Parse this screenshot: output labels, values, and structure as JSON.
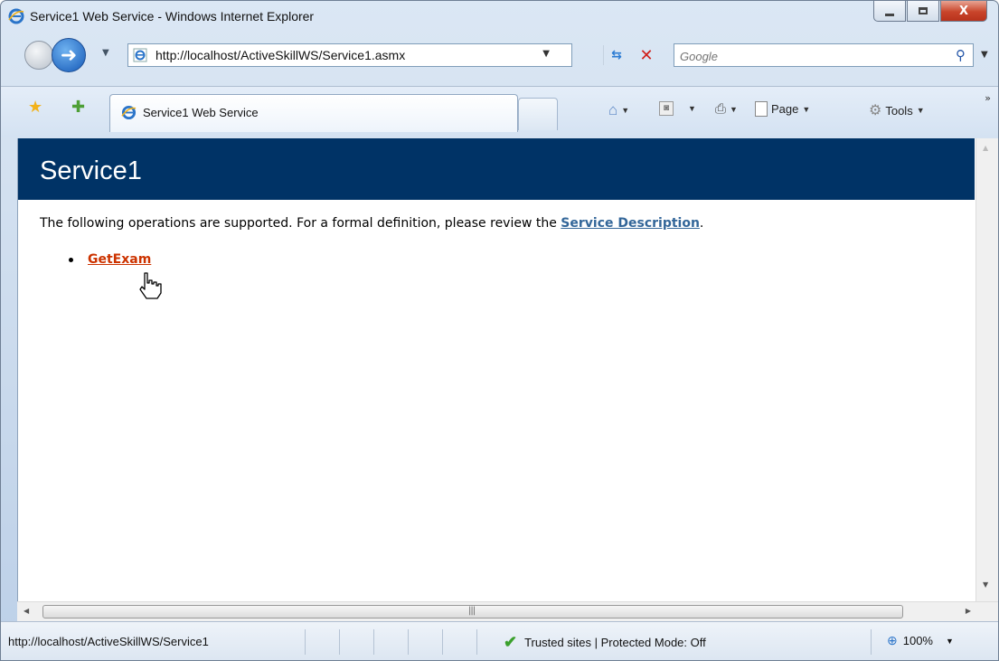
{
  "window": {
    "title": "Service1 Web Service - Windows Internet Explorer",
    "minimize_icon": "minimize-icon",
    "maximize_icon": "maximize-icon",
    "close_label": "X"
  },
  "navbar": {
    "address_url": "http://localhost/ActiveSkillWS/Service1.asmx",
    "search_placeholder": "Google"
  },
  "tabbar": {
    "active_tab_label": "Service1 Web Service",
    "page_label": "Page",
    "tools_label": "Tools"
  },
  "page": {
    "heading": "Service1",
    "intro_text": "The following operations are supported. For a formal definition, please review the ",
    "service_description_link": "Service Description",
    "intro_tail": ".",
    "operations": [
      "GetExam"
    ]
  },
  "statusbar": {
    "url": "http://localhost/ActiveSkillWS/Service1",
    "zone": "Trusted sites | Protected Mode: Off",
    "zoom": "100%"
  },
  "colors": {
    "banner": "#003366",
    "operation_link": "#cc3300",
    "service_link": "#336699"
  },
  "icons": {
    "back": "back-arrow-icon",
    "forward": "forward-arrow-icon",
    "refresh": "refresh-icon",
    "stop": "stop-icon",
    "search": "magnifier-icon",
    "favorites": "favorites-star-icon",
    "add_favorites": "add-favorites-icon",
    "home": "home-icon",
    "feeds": "feeds-icon",
    "print": "print-icon",
    "page": "page-icon",
    "tools": "gear-icon",
    "trusted": "checkmark-icon",
    "zoom": "zoom-icon",
    "cursor": "hand-pointer-icon"
  }
}
